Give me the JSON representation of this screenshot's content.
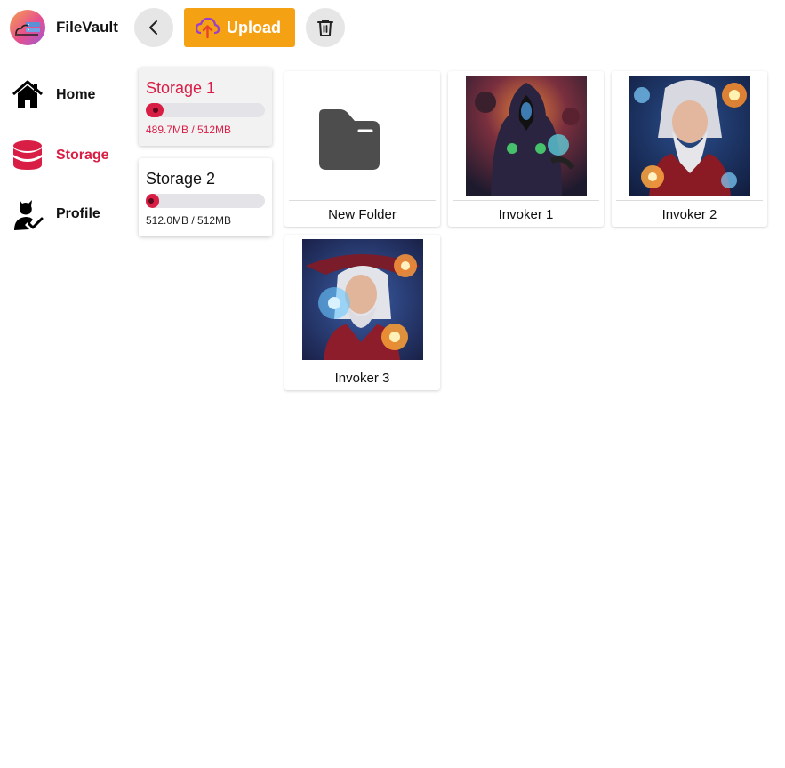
{
  "app": {
    "title": "FileVault"
  },
  "toolbar": {
    "upload_label": "Upload"
  },
  "nav": [
    {
      "label": "Home",
      "icon": "home-icon",
      "active": false
    },
    {
      "label": "Storage",
      "icon": "database-icon",
      "active": true
    },
    {
      "label": "Profile",
      "icon": "user-check-icon",
      "active": false
    }
  ],
  "storages": [
    {
      "name": "Storage 1",
      "usage": "489.7MB / 512MB",
      "fill": 0.15,
      "active": true
    },
    {
      "name": "Storage 2",
      "usage": "512.0MB / 512MB",
      "fill": 0.11,
      "active": false
    }
  ],
  "files": [
    {
      "name": "New Folder",
      "type": "folder"
    },
    {
      "name": "Invoker 1",
      "type": "image"
    },
    {
      "name": "Invoker 2",
      "type": "image"
    },
    {
      "name": "Invoker 3",
      "type": "image"
    }
  ],
  "colors": {
    "accent": "#d91e46",
    "upload": "#f5a114",
    "folder": "#4d4d4d"
  }
}
